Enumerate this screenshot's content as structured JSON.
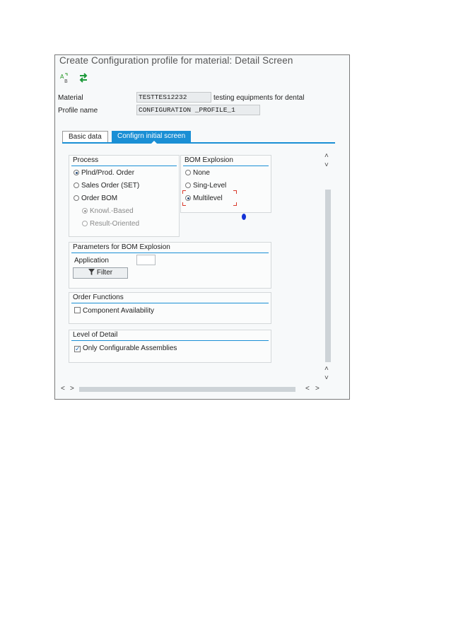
{
  "window": {
    "title": "Create Configuration profile for material: Detail Screen"
  },
  "toolbar": {
    "icons": [
      "abc-sort-icon",
      "swap-arrows-icon"
    ]
  },
  "header": {
    "material_label": "Material",
    "material_value": "TESTTES12232",
    "material_desc": "testing equipments for dental",
    "profile_label": "Profile name",
    "profile_value": "CONFIGURATION _PROFILE_1"
  },
  "tabs": [
    {
      "label": "Basic data",
      "active": false
    },
    {
      "label": "Configrn initial screen",
      "active": true
    }
  ],
  "process": {
    "title": "Process",
    "options": [
      "Plnd/Prod. Order",
      "Sales Order (SET)",
      "Order BOM"
    ],
    "selected": "Plnd/Prod. Order",
    "sub_options": [
      "Knowl.-Based",
      "Result-Oriented"
    ]
  },
  "bom_explosion": {
    "title": "BOM Explosion",
    "options": [
      "None",
      "Sing-Level",
      "Multilevel"
    ],
    "selected": "Multilevel"
  },
  "parameters": {
    "title": "Parameters for BOM Explosion",
    "application_label": "Application",
    "application_value": "",
    "filter_button": "Filter"
  },
  "order_functions": {
    "title": "Order Functions",
    "component_availability": "Component Availability",
    "component_availability_checked": false
  },
  "level_of_detail": {
    "title": "Level of Detail",
    "only_configurable": "Only Configurable Assemblies",
    "only_configurable_checked": true
  },
  "colors": {
    "accent": "#1a8fd5",
    "focus": "#d9392b"
  }
}
